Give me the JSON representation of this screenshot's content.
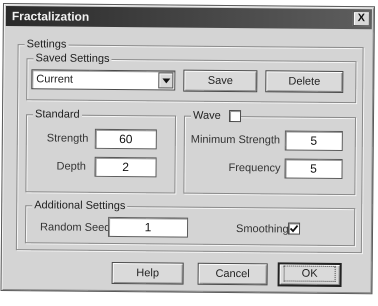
{
  "window": {
    "title": "Fractalization",
    "close_glyph": "X"
  },
  "settings": {
    "label": "Settings",
    "saved": {
      "label": "Saved Settings",
      "selected": "Current",
      "save_label": "Save",
      "delete_label": "Delete"
    },
    "standard": {
      "label": "Standard",
      "strength_label": "Strength",
      "strength_value": "60",
      "depth_label": "Depth",
      "depth_value": "2"
    },
    "wave": {
      "label": "Wave",
      "checked": false,
      "min_strength_label": "Minimum Strength",
      "min_strength_value": "5",
      "frequency_label": "Frequency",
      "frequency_value": "5"
    },
    "additional": {
      "label": "Additional Settings",
      "seed_label": "Random Seed",
      "seed_value": "1",
      "smoothing_label": "Smoothing",
      "smoothing_checked": true
    }
  },
  "footer": {
    "help_label": "Help",
    "cancel_label": "Cancel",
    "ok_label": "OK"
  }
}
